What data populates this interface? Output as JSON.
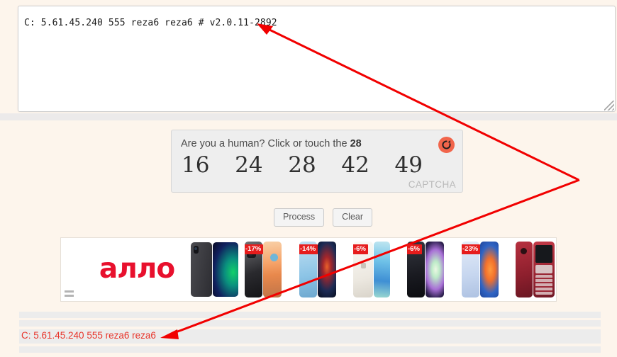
{
  "textarea": {
    "value": "C: 5.61.45.240 555 reza6 reza6 # v2.0.11-2892"
  },
  "captcha": {
    "question_prefix": "Are you a human? Click or touch the ",
    "target": "28",
    "numbers": [
      "16",
      "24",
      "28",
      "42",
      "49"
    ],
    "label": "CAPTCHA",
    "refresh_icon": "refresh-icon",
    "accent_color": "#f1654b"
  },
  "buttons": {
    "process": "Process",
    "clear": "Clear"
  },
  "carousel": {
    "logo_text": "алло",
    "handle_icon": "drag-handle-icon",
    "products": [
      {
        "name": "xiaomi-tablet",
        "badge": ""
      },
      {
        "name": "redmi-note-12-pro",
        "badge": "-17%"
      },
      {
        "name": "phone-blue-gaming",
        "badge": "-14%"
      },
      {
        "name": "iphone-13-starlight",
        "badge": "-6%"
      },
      {
        "name": "iphone-14-midnight",
        "badge": "-6%"
      },
      {
        "name": "redmi-12-blue",
        "badge": "-23%"
      },
      {
        "name": "nokia-150-red",
        "badge": ""
      }
    ]
  },
  "footer": {
    "status_text": "C: 5.61.45.240 555 reza6 reza6",
    "status_color": "#e8352b"
  },
  "annotations": {
    "arrow_1": "arrow-pointing-to-textarea-version",
    "arrow_2": "arrow-pointing-to-footer-status"
  }
}
